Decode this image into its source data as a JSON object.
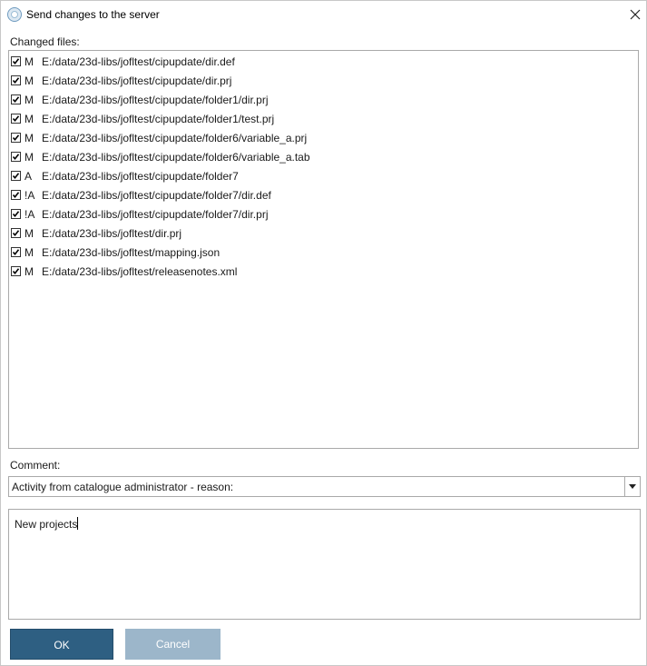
{
  "window": {
    "title": "Send changes to the server",
    "icon": "app-globe-icon",
    "close_icon": "close-icon"
  },
  "changed_files": {
    "label": "Changed files:",
    "files": [
      {
        "checked": true,
        "status": "M",
        "path": "E:/data/23d-libs/jofltest/cipupdate/dir.def"
      },
      {
        "checked": true,
        "status": "M",
        "path": "E:/data/23d-libs/jofltest/cipupdate/dir.prj"
      },
      {
        "checked": true,
        "status": "M",
        "path": "E:/data/23d-libs/jofltest/cipupdate/folder1/dir.prj"
      },
      {
        "checked": true,
        "status": "M",
        "path": "E:/data/23d-libs/jofltest/cipupdate/folder1/test.prj"
      },
      {
        "checked": true,
        "status": "M",
        "path": "E:/data/23d-libs/jofltest/cipupdate/folder6/variable_a.prj"
      },
      {
        "checked": true,
        "status": "M",
        "path": "E:/data/23d-libs/jofltest/cipupdate/folder6/variable_a.tab"
      },
      {
        "checked": true,
        "status": "A",
        "path": "E:/data/23d-libs/jofltest/cipupdate/folder7"
      },
      {
        "checked": true,
        "status": "!A",
        "path": "E:/data/23d-libs/jofltest/cipupdate/folder7/dir.def"
      },
      {
        "checked": true,
        "status": "!A",
        "path": "E:/data/23d-libs/jofltest/cipupdate/folder7/dir.prj"
      },
      {
        "checked": true,
        "status": "M",
        "path": "E:/data/23d-libs/jofltest/dir.prj"
      },
      {
        "checked": true,
        "status": "M",
        "path": "E:/data/23d-libs/jofltest/mapping.json"
      },
      {
        "checked": true,
        "status": "M",
        "path": "E:/data/23d-libs/jofltest/releasenotes.xml"
      }
    ]
  },
  "comment": {
    "label": "Comment:",
    "template_selected": "Activity from catalogue administrator - reason:",
    "text": "New projects"
  },
  "buttons": {
    "ok": "OK",
    "cancel": "Cancel"
  },
  "colors": {
    "ok_bg": "#2e5f82",
    "cancel_bg": "#9cb6ca"
  }
}
